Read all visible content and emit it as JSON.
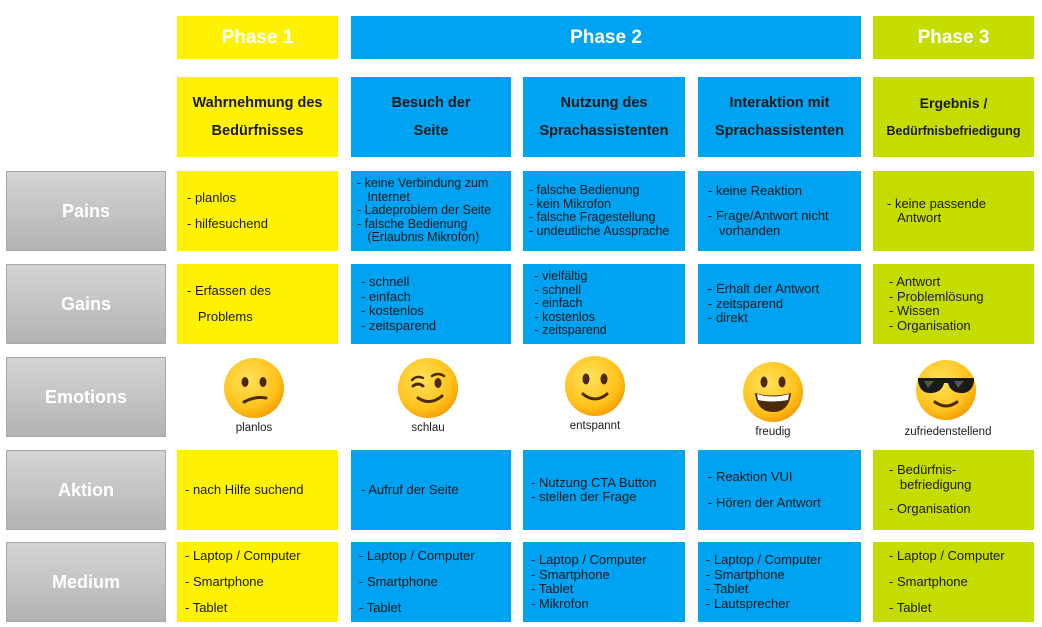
{
  "phases": [
    "Phase 1",
    "Phase 2",
    "Phase 3"
  ],
  "columns": [
    {
      "line1": "Wahrnehmung des",
      "line2": "Bedürfnisses"
    },
    {
      "line1": "Besuch der",
      "line2": "Seite"
    },
    {
      "line1": "Nutzung des",
      "line2": "Sprachassistenten"
    },
    {
      "line1": "Interaktion mit",
      "line2": "Sprachassistenten"
    },
    {
      "line1": "Ergebnis /",
      "line2": "Bedürfnisbefriedigung"
    }
  ],
  "rows": [
    "Pains",
    "Gains",
    "Emotions",
    "Aktion",
    "Medium"
  ],
  "pains": [
    [
      "- planlos",
      "- hilfesuchend"
    ],
    [
      "- keine Verbindung zum",
      "   Internet",
      "- Ladeproblem der Seite",
      "- falsche Bedienung",
      "   (Erlaubnis Mikrofon)"
    ],
    [
      "- falsche Bedienung",
      "- kein Mikrofon",
      "- falsche Fragestellung",
      "- undeutliche Aussprache"
    ],
    [
      "- keine Reaktion",
      "",
      "- Frage/Antwort nicht",
      "   vorhanden"
    ],
    [
      "- keine passende",
      "   Antwort"
    ]
  ],
  "gains": [
    [
      "- Erfassen des",
      "   Problems"
    ],
    [
      "- schnell",
      "- einfach",
      "- kostenlos",
      "- zeitsparend"
    ],
    [
      " - vielfältig",
      " - schnell",
      " - einfach",
      " - kostenlos",
      " - zeitsparend"
    ],
    [
      "- Erhalt der Antwort",
      "- zeitsparend",
      "- direkt"
    ],
    [
      "- Antwort",
      "- Problemlösung",
      "- Wissen",
      "- Organisation"
    ]
  ],
  "emotions": [
    {
      "label": "planlos",
      "icon": "confused-face-icon"
    },
    {
      "label": "schlau",
      "icon": "winking-face-icon"
    },
    {
      "label": "entspannt",
      "icon": "slightly-smiling-face-icon"
    },
    {
      "label": "freudig",
      "icon": "grinning-face-icon"
    },
    {
      "label": "zufriedenstellend",
      "icon": "sunglasses-face-icon"
    }
  ],
  "aktion": [
    [
      "- nach Hilfe suchend"
    ],
    [
      "- Aufruf der Seite"
    ],
    [
      "- Nutzung CTA Button",
      "- stellen der Frage"
    ],
    [
      "- Reaktion VUI",
      "",
      "- Hören der Antwort"
    ],
    [
      "- Bedürfnis-",
      "   befriedigung",
      "",
      "- Organisation"
    ]
  ],
  "medium": [
    [
      "- Laptop / Computer",
      "- Smartphone",
      "- Tablet"
    ],
    [
      "- Laptop / Computer",
      "- Smartphone",
      "- Tablet"
    ],
    [
      "- Laptop / Computer",
      "- Smartphone",
      "- Tablet",
      "- Mikrofon"
    ],
    [
      "- Laptop / Computer",
      "- Smartphone",
      "- Tablet",
      "- Lautsprecher"
    ],
    [
      "- Laptop / Computer",
      "- Smartphone",
      "- Tablet"
    ]
  ],
  "colors": {
    "yellow": "#fff200",
    "blue": "#00a2f2",
    "green": "#c4dc00",
    "row_label": "#c6c6c6"
  }
}
